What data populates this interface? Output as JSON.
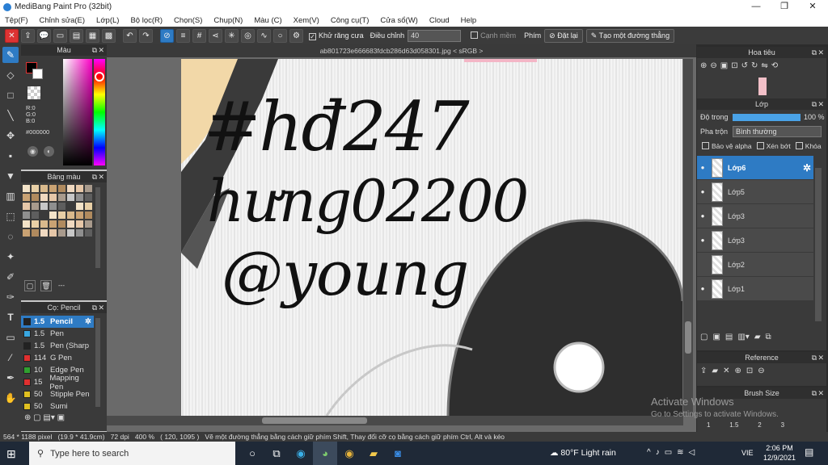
{
  "window": {
    "title": "MediBang Paint Pro (32bit)"
  },
  "menu": [
    "Tệp(F)",
    "Chỉnh sửa(E)",
    "Lớp(L)",
    "Bộ lọc(R)",
    "Chọn(S)",
    "Chụp(N)",
    "Màu (C)",
    "Xem(V)",
    "Công cụ(T)",
    "Cửa sổ(W)",
    "Cloud",
    "Help"
  ],
  "toolbar": {
    "antialias_label": "Khử răng cưa",
    "adjust_label": "Điều chỉnh",
    "adjust_value": "40",
    "edge_label": "Cạnh mềm",
    "key_label": "Phím",
    "reset_label": "Đặt lại",
    "straight_label": "Tạo một đường thẳng"
  },
  "color_panel": {
    "title": "Màu",
    "r": "R:0",
    "g": "G:0",
    "b": "B:0",
    "hex": "#000000"
  },
  "palette_panel": {
    "title": "Bảng màu",
    "footer": "---"
  },
  "brush_panel": {
    "title": "Cọ: Pencil",
    "items": [
      {
        "size": "1.5",
        "name": "Pencil",
        "color": "#222222"
      },
      {
        "size": "1.5",
        "name": "Pen",
        "color": "#39a7e0"
      },
      {
        "size": "1.5",
        "name": "Pen (Sharp",
        "color": "#222222"
      },
      {
        "size": "114",
        "name": "G Pen",
        "color": "#e03030"
      },
      {
        "size": "10",
        "name": "Edge Pen",
        "color": "#30a030"
      },
      {
        "size": "15",
        "name": "Mapping Pen",
        "color": "#e03030"
      },
      {
        "size": "50",
        "name": "Stipple Pen",
        "color": "#e0c020"
      },
      {
        "size": "50",
        "name": "Sumi",
        "color": "#e0c020"
      }
    ]
  },
  "doc_tab": "ab801723e666683fdcb286d63d058301.jpg < sRGB >",
  "canvas_text": [
    "#hđ247",
    "hưng02200",
    "@young"
  ],
  "navigator": {
    "title": "Hoa tiêu"
  },
  "layer_panel": {
    "title": "Lớp",
    "opacity_label": "Độ trong",
    "opacity_value": "100 %",
    "blend_label": "Pha trộn",
    "blend_value": "Bình thường",
    "protect_alpha": "Bảo vệ alpha",
    "clip": "Xén bớt",
    "lock": "Khóa",
    "layers": [
      {
        "name": "Lớp6",
        "selected": true
      },
      {
        "name": "Lớp5",
        "selected": false
      },
      {
        "name": "Lớp3",
        "selected": false
      },
      {
        "name": "Lớp3",
        "selected": false
      },
      {
        "name": "Lớp2",
        "selected": false
      },
      {
        "name": "Lớp1",
        "selected": false
      }
    ]
  },
  "reference": {
    "title": "Reference"
  },
  "brush_size": {
    "title": "Brush Size",
    "sizes": [
      "1",
      "1.5",
      "2",
      "3"
    ]
  },
  "status": {
    "dims": "564 * 1188 pixel",
    "cm": "(19.9 * 41.9cm)",
    "dpi": "72 dpi",
    "zoom": "400 %",
    "coords": "( 120, 1095 )",
    "hint": "Vẽ một đường thẳng bằng cách giữ phím Shift, Thay đổi cỡ cọ bằng cách giữ phím Ctrl, Alt và kéo"
  },
  "watermark": {
    "title": "Activate Windows",
    "sub": "Go to Settings to activate Windows."
  },
  "taskbar": {
    "search_placeholder": "Type here to search",
    "weather": "80°F  Light rain",
    "lang": "VIE",
    "time": "2:06 PM",
    "date": "12/9/2021"
  }
}
